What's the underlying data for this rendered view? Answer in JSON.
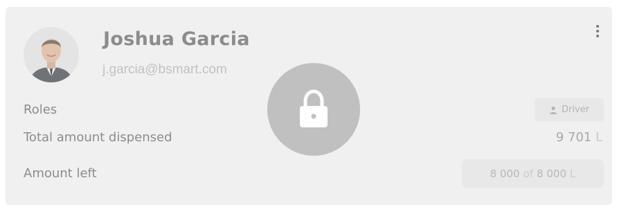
{
  "user": {
    "name": "Joshua Garcia",
    "email": "j.garcia@bsmart.com",
    "avatar_icon": "user-photo"
  },
  "rows": {
    "roles_label": "Roles",
    "role_chip_label": "Driver",
    "role_chip_icon": "person-icon",
    "dispensed_label": "Total amount dispensed",
    "dispensed_value": "9 701",
    "dispensed_unit": "L",
    "left_label": "Amount left",
    "left_current": "8 000",
    "left_of": "of",
    "left_total": "8 000",
    "left_unit": "L"
  },
  "overlay": {
    "icon": "lock-icon"
  },
  "menu": {
    "icon": "kebab-menu-icon"
  },
  "colors": {
    "card_bg": "#f0f0f0",
    "overlay_circle": "#c0c0c0",
    "text_muted": "#8c8c8c"
  }
}
